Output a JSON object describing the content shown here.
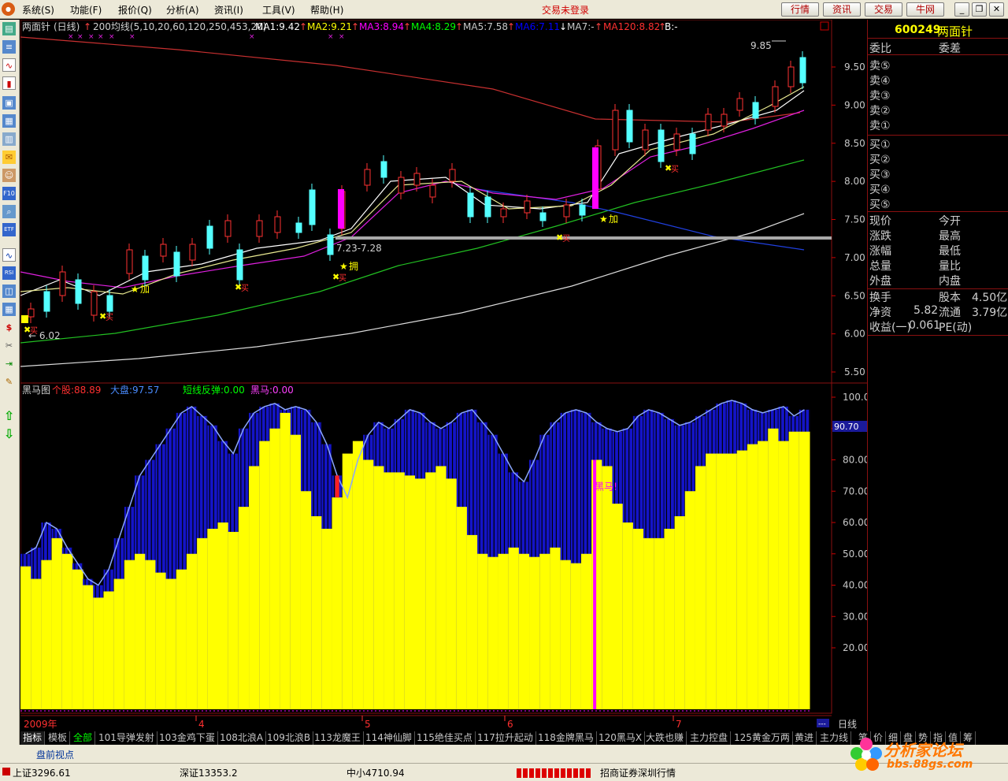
{
  "menu": {
    "items": [
      "系统(S)",
      "功能(F)",
      "报价(Q)",
      "分析(A)",
      "资讯(I)",
      "工具(V)",
      "帮助(H)"
    ],
    "login_status": "交易未登录",
    "buttons": [
      "行情",
      "资讯",
      "交易",
      "牛网"
    ],
    "window_buttons": [
      "_",
      "❐",
      "✕"
    ]
  },
  "toolbar_icons": [
    "quote-icon",
    "list-icon",
    "line-chart-icon",
    "candle-chart-icon",
    "window-icon",
    "table-icon",
    "report-icon",
    "mail-icon",
    "users-icon",
    "f10-icon",
    "search-icon",
    "etf-icon",
    "trend-icon",
    "rsi-icon",
    "layout-icon",
    "money-icon",
    "tool-icon",
    "export-icon",
    "pen-icon",
    "up-arrow-icon",
    "down-arrow-icon"
  ],
  "toolbar_labels": {
    "etf": "ETF",
    "rsi": "RSI",
    "f10": "F10"
  },
  "stock": {
    "code": "600249",
    "name": "两面针"
  },
  "main_chart": {
    "header_name": "两面针",
    "header_period": "(日线)",
    "indicator": "200均线(5,10,20,60,120,250,453,20)",
    "ma": [
      {
        "label": "MA1:9.42",
        "color": "#ffffff"
      },
      {
        "label": "MA2:9.21",
        "color": "#ffff00"
      },
      {
        "label": "MA3:8.94",
        "color": "#ff00ff"
      },
      {
        "label": "MA4:8.29",
        "color": "#00ff00"
      },
      {
        "label": "MA5:7.58",
        "color": "#c8c8c8"
      },
      {
        "label": "MA6:7.11",
        "color": "#0000ff"
      },
      {
        "label": "MA7:-",
        "color": "#c8c8c8"
      },
      {
        "label": "MA120:8.82",
        "color": "#ff3030"
      },
      {
        "label": "B:-",
        "color": "#ffffff"
      }
    ],
    "price_ticks": [
      "9.50",
      "9.00",
      "8.50",
      "8.00",
      "7.50",
      "7.00",
      "6.50",
      "6.00",
      "5.50"
    ],
    "annotations": {
      "high": "9.85",
      "low": "6.02",
      "range": "7.23-7.28",
      "add1": "加",
      "add2": "加",
      "hold": "拥",
      "buy": "买"
    }
  },
  "sub_chart": {
    "title": "黑马图",
    "stock_label": "个股:88.89",
    "market_label": "大盘:97.57",
    "rebound_label": "短线反弹:0.00",
    "horse_label": "黑马:0.00",
    "ticks": [
      "100.0",
      "90.00",
      "80.00",
      "70.00",
      "60.00",
      "50.00",
      "40.00",
      "30.00",
      "20.00"
    ],
    "cursor_value": "90.70",
    "horse_marker": "黑马!"
  },
  "chart_data": {
    "type": "bar",
    "title": "黑马图",
    "ylim": [
      0,
      100
    ],
    "series": [
      {
        "name": "大盘",
        "color": "#1414c8",
        "values": [
          50,
          52,
          60,
          58,
          52,
          47,
          42,
          40,
          45,
          55,
          65,
          75,
          80,
          85,
          90,
          95,
          97,
          94,
          91,
          86,
          82,
          90,
          95,
          97,
          98,
          96,
          97,
          96,
          92,
          85,
          75,
          68,
          80,
          88,
          92,
          90,
          93,
          96,
          95,
          92,
          90,
          92,
          95,
          96,
          92,
          88,
          82,
          76,
          73,
          80,
          88,
          92,
          95,
          96,
          95,
          92,
          90,
          89,
          90,
          94,
          96,
          95,
          93,
          91,
          92,
          94,
          96,
          98,
          99,
          98,
          96,
          95,
          96,
          97,
          94,
          96
        ]
      },
      {
        "name": "个股",
        "color": "#ffff00",
        "values": [
          46,
          42,
          48,
          55,
          50,
          45,
          40,
          36,
          38,
          42,
          48,
          50,
          48,
          44,
          42,
          45,
          50,
          55,
          58,
          60,
          57,
          65,
          78,
          86,
          90,
          95,
          88,
          70,
          62,
          58,
          68,
          82,
          86,
          80,
          78,
          76,
          76,
          75,
          74,
          76,
          78,
          74,
          65,
          56,
          50,
          49,
          50,
          52,
          50,
          49,
          50,
          52,
          48,
          47,
          50,
          80,
          78,
          66,
          60,
          58,
          55,
          55,
          58,
          62,
          70,
          78,
          82,
          82,
          82,
          83,
          85,
          86,
          90,
          86,
          89,
          89
        ]
      }
    ],
    "notes": "price axis 5.50-9.50; last close near 9.42"
  },
  "date_axis": {
    "year": "2009年",
    "months": [
      "4",
      "5",
      "6",
      "7"
    ],
    "period_button": "日线"
  },
  "tabs": [
    "指标",
    "模板",
    "全部",
    "101导弹发射",
    "103金鸡下蛋",
    "108北浪A",
    "109北浪B",
    "113龙魔王",
    "114神仙脚",
    "115绝佳买点",
    "117拉升起动",
    "118金牌黑马",
    "120黑马X",
    "大跌也赚",
    "主力控盘",
    "125黄金万两",
    "黄进",
    "主力线"
  ],
  "side_tabs": [
    "笔",
    "价",
    "细",
    "盘",
    "势",
    "指",
    "值",
    "筹"
  ],
  "side_panel": {
    "header_code": "600249",
    "header_name": "两面针",
    "order_head_left": "委比",
    "order_head_right": "委差",
    "sells": [
      "卖⑤",
      "卖④",
      "卖③",
      "卖②",
      "卖①"
    ],
    "buys": [
      "买①",
      "买②",
      "买③",
      "买④",
      "买⑤"
    ],
    "quote_rows": [
      {
        "l": "现价",
        "lv": "",
        "r": "今开",
        "rv": ""
      },
      {
        "l": "涨跌",
        "lv": "",
        "r": "最高",
        "rv": ""
      },
      {
        "l": "涨幅",
        "lv": "",
        "r": "最低",
        "rv": ""
      },
      {
        "l": "总量",
        "lv": "",
        "r": "量比",
        "rv": ""
      },
      {
        "l": "外盘",
        "lv": "",
        "r": "内盘",
        "rv": ""
      }
    ],
    "fin_rows": [
      {
        "l": "换手",
        "lv": "",
        "r": "股本",
        "rv": "4.50亿"
      },
      {
        "l": "净资",
        "lv": "5.82",
        "r": "流通",
        "rv": "3.79亿"
      },
      {
        "l": "收益(一)",
        "lv": "0.061",
        "r": "PE(动)",
        "rv": ""
      }
    ]
  },
  "status": {
    "row1": "盘前视点",
    "sh": "上证3296.61",
    "sz": "深证13353.2",
    "sme": "中小4710.94",
    "broker": "招商证券深圳行情"
  },
  "watermark": {
    "text": "分析家论坛",
    "url": "bbs.88gs.com"
  }
}
